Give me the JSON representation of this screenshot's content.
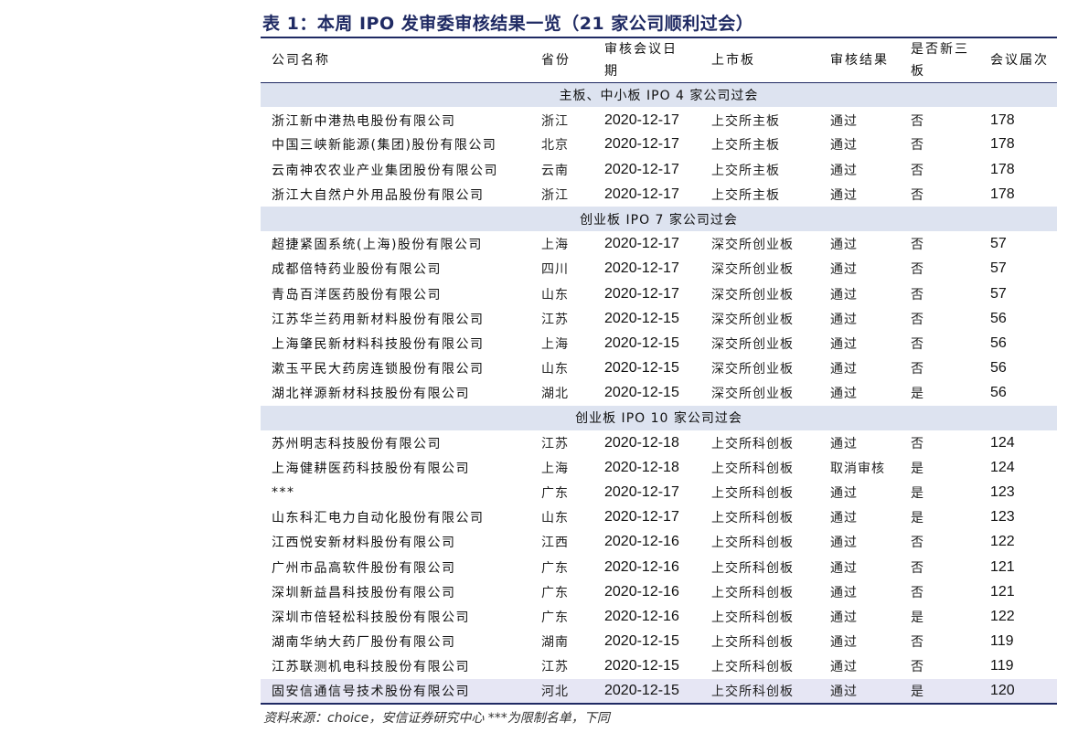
{
  "title": "表 1：本周 IPO 发审委审核结果一览（21 家公司顺利过会）",
  "headers": {
    "company": "公司名称",
    "province": "省份",
    "date_line1": "审核会议日",
    "date_line2": "期",
    "board": "上市板",
    "result": "审核结果",
    "nq_line1": "是否新三",
    "nq_line2": "板",
    "session": "会议届次"
  },
  "sections": [
    {
      "label": "主板、中小板 IPO 4 家公司过会",
      "rows": [
        {
          "company": "浙江新中港热电股份有限公司",
          "province": "浙江",
          "date": "2020-12-17",
          "board": "上交所主板",
          "result": "通过",
          "new_third_board": "否",
          "session": "178"
        },
        {
          "company": "中国三峡新能源(集团)股份有限公司",
          "province": "北京",
          "date": "2020-12-17",
          "board": "上交所主板",
          "result": "通过",
          "new_third_board": "否",
          "session": "178"
        },
        {
          "company": "云南神农农业产业集团股份有限公司",
          "province": "云南",
          "date": "2020-12-17",
          "board": "上交所主板",
          "result": "通过",
          "new_third_board": "否",
          "session": "178"
        },
        {
          "company": "浙江大自然户外用品股份有限公司",
          "province": "浙江",
          "date": "2020-12-17",
          "board": "上交所主板",
          "result": "通过",
          "new_third_board": "否",
          "session": "178"
        }
      ]
    },
    {
      "label": "创业板 IPO 7 家公司过会",
      "rows": [
        {
          "company": "超捷紧固系统(上海)股份有限公司",
          "province": "上海",
          "date": "2020-12-17",
          "board": "深交所创业板",
          "result": "通过",
          "new_third_board": "否",
          "session": "57"
        },
        {
          "company": "成都倍特药业股份有限公司",
          "province": "四川",
          "date": "2020-12-17",
          "board": "深交所创业板",
          "result": "通过",
          "new_third_board": "否",
          "session": "57"
        },
        {
          "company": "青岛百洋医药股份有限公司",
          "province": "山东",
          "date": "2020-12-17",
          "board": "深交所创业板",
          "result": "通过",
          "new_third_board": "否",
          "session": "57"
        },
        {
          "company": "江苏华兰药用新材料股份有限公司",
          "province": "江苏",
          "date": "2020-12-15",
          "board": "深交所创业板",
          "result": "通过",
          "new_third_board": "否",
          "session": "56"
        },
        {
          "company": "上海肇民新材料科技股份有限公司",
          "province": "上海",
          "date": "2020-12-15",
          "board": "深交所创业板",
          "result": "通过",
          "new_third_board": "否",
          "session": "56"
        },
        {
          "company": "漱玉平民大药房连锁股份有限公司",
          "province": "山东",
          "date": "2020-12-15",
          "board": "深交所创业板",
          "result": "通过",
          "new_third_board": "否",
          "session": "56"
        },
        {
          "company": "湖北祥源新材科技股份有限公司",
          "province": "湖北",
          "date": "2020-12-15",
          "board": "深交所创业板",
          "result": "通过",
          "new_third_board": "是",
          "session": "56"
        }
      ]
    },
    {
      "label": "创业板 IPO 10 家公司过会",
      "rows": [
        {
          "company": "苏州明志科技股份有限公司",
          "province": "江苏",
          "date": "2020-12-18",
          "board": "上交所科创板",
          "result": "通过",
          "new_third_board": "否",
          "session": "124"
        },
        {
          "company": "上海健耕医药科技股份有限公司",
          "province": "上海",
          "date": "2020-12-18",
          "board": "上交所科创板",
          "result": "取消审核",
          "new_third_board": "是",
          "session": "124"
        },
        {
          "company": "***",
          "province": "广东",
          "date": "2020-12-17",
          "board": "上交所科创板",
          "result": "通过",
          "new_third_board": "是",
          "session": "123"
        },
        {
          "company": "山东科汇电力自动化股份有限公司",
          "province": "山东",
          "date": "2020-12-17",
          "board": "上交所科创板",
          "result": "通过",
          "new_third_board": "是",
          "session": "123"
        },
        {
          "company": "江西悦安新材料股份有限公司",
          "province": "江西",
          "date": "2020-12-16",
          "board": "上交所科创板",
          "result": "通过",
          "new_third_board": "否",
          "session": "122"
        },
        {
          "company": "广州市品高软件股份有限公司",
          "province": "广东",
          "date": "2020-12-16",
          "board": "上交所科创板",
          "result": "通过",
          "new_third_board": "否",
          "session": "121"
        },
        {
          "company": "深圳新益昌科技股份有限公司",
          "province": "广东",
          "date": "2020-12-16",
          "board": "上交所科创板",
          "result": "通过",
          "new_third_board": "否",
          "session": "121"
        },
        {
          "company": "深圳市倍轻松科技股份有限公司",
          "province": "广东",
          "date": "2020-12-16",
          "board": "上交所科创板",
          "result": "通过",
          "new_third_board": "是",
          "session": "122"
        },
        {
          "company": "湖南华纳大药厂股份有限公司",
          "province": "湖南",
          "date": "2020-12-15",
          "board": "上交所科创板",
          "result": "通过",
          "new_third_board": "否",
          "session": "119"
        },
        {
          "company": "江苏联测机电科技股份有限公司",
          "province": "江苏",
          "date": "2020-12-15",
          "board": "上交所科创板",
          "result": "通过",
          "new_third_board": "否",
          "session": "119"
        },
        {
          "company": "固安信通信号技术股份有限公司",
          "province": "河北",
          "date": "2020-12-15",
          "board": "上交所科创板",
          "result": "通过",
          "new_third_board": "是",
          "session": "120"
        }
      ]
    }
  ],
  "source": "资料来源：choice，安信证券研究中心 ***为限制名单，下同",
  "colors": {
    "title": "#1f2a63",
    "rule": "#1f2a63",
    "section_bg": "#dde3f0",
    "highlight_row_bg": "#e6e6f4"
  }
}
